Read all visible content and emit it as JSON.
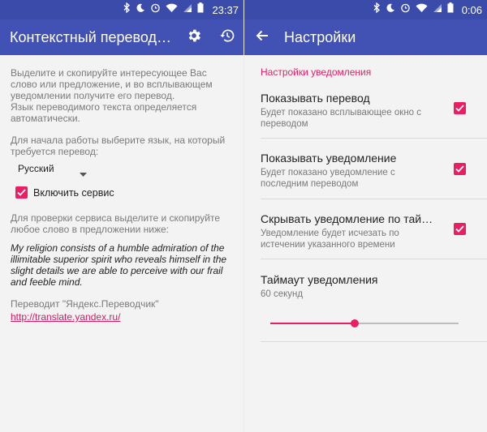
{
  "left": {
    "status": {
      "time": "23:37"
    },
    "appbar": {
      "title": "Контекстный переводч..."
    },
    "intro_text": "Выделите и скопируйте интересующее Вас слово или предложение, и во всплывающем уведомлении получите его перевод.",
    "lang_note": "Язык переводимого текста определяется автоматически.",
    "choose_lang_text": "Для начала работы выберите язык, на который требуется перевод:",
    "language_select": {
      "selected": "Русский"
    },
    "enable_service": {
      "label": "Включить сервис",
      "checked": true
    },
    "check_text": "Для проверки сервиса выделите и скопируйте любое слово в предложении ниже:",
    "sample_quote": "My religion consists of a humble admiration of the illimitable superior spirit who reveals himself in the slight details we are able to perceive with our frail and feeble mind.",
    "credit": "Переводит \"Яндекс.Переводчик\"",
    "credit_link": "http://translate.yandex.ru/"
  },
  "right": {
    "status": {
      "time": "0:06"
    },
    "appbar": {
      "title": "Настройки"
    },
    "section_title": "Настройки уведомления",
    "prefs": [
      {
        "title": "Показывать перевод",
        "summary": "Будет показано всплывающее окно с переводом",
        "checked": true
      },
      {
        "title": "Показывать уведомление",
        "summary": "Будет показано уведомление с последним переводом",
        "checked": true
      },
      {
        "title": "Скрывать уведомление по тайма..",
        "summary": "Уведомление будет исчезать по истечении указанного времени",
        "checked": true
      }
    ],
    "timeout": {
      "title": "Таймаут уведомления",
      "value_text": "60 секунд",
      "slider_fraction": 0.45
    }
  },
  "colors": {
    "status_bar": "#3a4ba9",
    "app_bar": "#4152b4",
    "accent": "#e91e63"
  },
  "icons": [
    "bluetooth-icon",
    "moon-icon",
    "alarm-icon",
    "wifi-icon",
    "signal-icon",
    "battery-icon",
    "gear-icon",
    "history-icon",
    "back-arrow-icon",
    "dropdown-arrow-icon",
    "check-icon"
  ]
}
